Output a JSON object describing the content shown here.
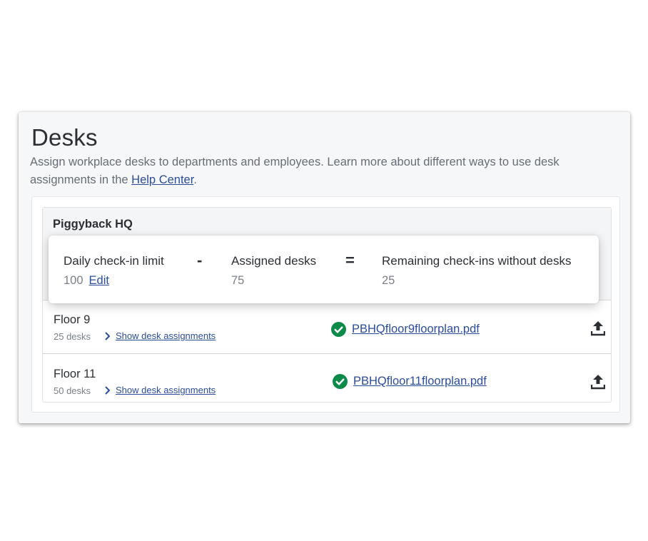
{
  "page": {
    "title": "Desks",
    "description_prefix": "Assign workplace desks to departments and employees. Learn more about different ways to use desk assignments in the ",
    "help_link": "Help Center",
    "description_suffix": "."
  },
  "location": {
    "name": "Piggyback HQ"
  },
  "summary": {
    "limit_label": "Daily check-in limit",
    "limit_value": "100",
    "edit_label": "Edit",
    "minus": "-",
    "assigned_label": "Assigned desks",
    "assigned_value": "75",
    "equals": "=",
    "remaining_label": "Remaining check-ins without desks",
    "remaining_value": "25"
  },
  "floors": [
    {
      "name": "Floor 9",
      "desks": "25 desks",
      "show_label": "Show desk assignments",
      "file": "PBHQfloor9floorplan.pdf"
    },
    {
      "name": "Floor 11",
      "desks": "50 desks",
      "show_label": "Show desk assignments",
      "file": "PBHQfloor11floorplan.pdf"
    }
  ],
  "icons": {
    "check": "check-circle-icon",
    "upload": "upload-icon",
    "chevron": "chevron-right-icon"
  },
  "colors": {
    "link": "#2b4c9b",
    "success": "#0b8a4a",
    "text": "#2b2f33"
  }
}
